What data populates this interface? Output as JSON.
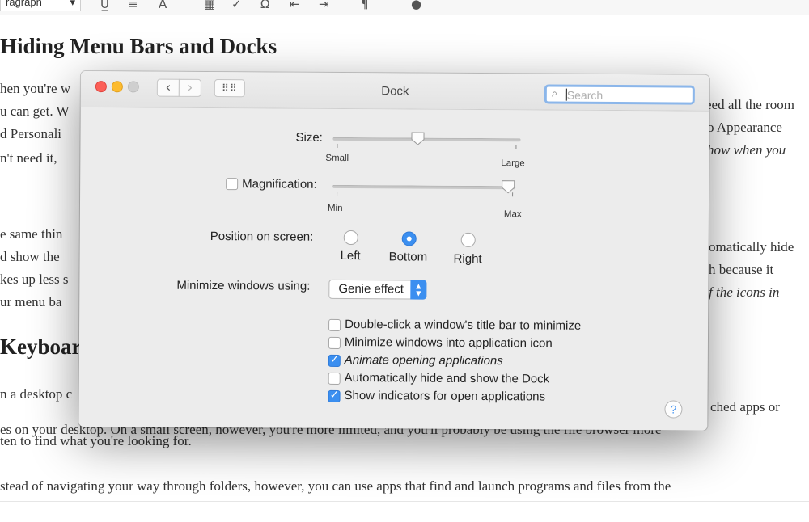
{
  "document": {
    "toolbar": {
      "format_value": "ragraph",
      "format_arrow": "▾"
    },
    "heading1": "Hiding Menu Bars and Docks",
    "heading2": "Keyboar",
    "lines_left": [
      "hen you're w",
      "u can get. W",
      "d Personali",
      "n't need it, ",
      "e same thin",
      "d show the",
      "kes up less s",
      "ur menu ba"
    ],
    "lines_right": [
      "eed all the room",
      "o Appearance",
      "how when you",
      "omatically hide",
      "h because it",
      "f the icons in"
    ],
    "lines_bottom": [
      "n a desktop c",
      "ched apps or",
      "es on your desktop. On a small screen, however, you're more limited, and you'll probably be using the file browser more",
      "ten to find what you're looking for.",
      "stead of navigating your way through folders, however, you can use apps that find and launch programs and files from the"
    ]
  },
  "window": {
    "title": "Dock",
    "search_placeholder": "Search",
    "nav": {
      "back": "‹",
      "forward": "›",
      "grid": "⠿⠿"
    },
    "size": {
      "label": "Size:",
      "min_label": "Small",
      "max_label": "Large",
      "value": 0.45
    },
    "magnification": {
      "label": "Magnification:",
      "checked": false,
      "min_label": "Min",
      "max_label": "Max",
      "value": 1.0
    },
    "position": {
      "label": "Position on screen:",
      "options": [
        "Left",
        "Bottom",
        "Right"
      ],
      "selected": "Bottom"
    },
    "minimize": {
      "label": "Minimize windows using:",
      "value": "Genie effect"
    },
    "checkboxes": [
      {
        "label": "Double-click a window's title bar to minimize",
        "checked": false
      },
      {
        "label": "Minimize windows into application icon",
        "checked": false
      },
      {
        "label": "Animate opening applications",
        "checked": true
      },
      {
        "label": "Automatically hide and show the Dock",
        "checked": false
      },
      {
        "label": "Show indicators for open applications",
        "checked": true
      }
    ],
    "help": "?"
  },
  "colors": {
    "accent": "#3b8ff0",
    "window_bg": "#ececec",
    "close": "#fc5f57",
    "minimize": "#fdbb2e"
  }
}
